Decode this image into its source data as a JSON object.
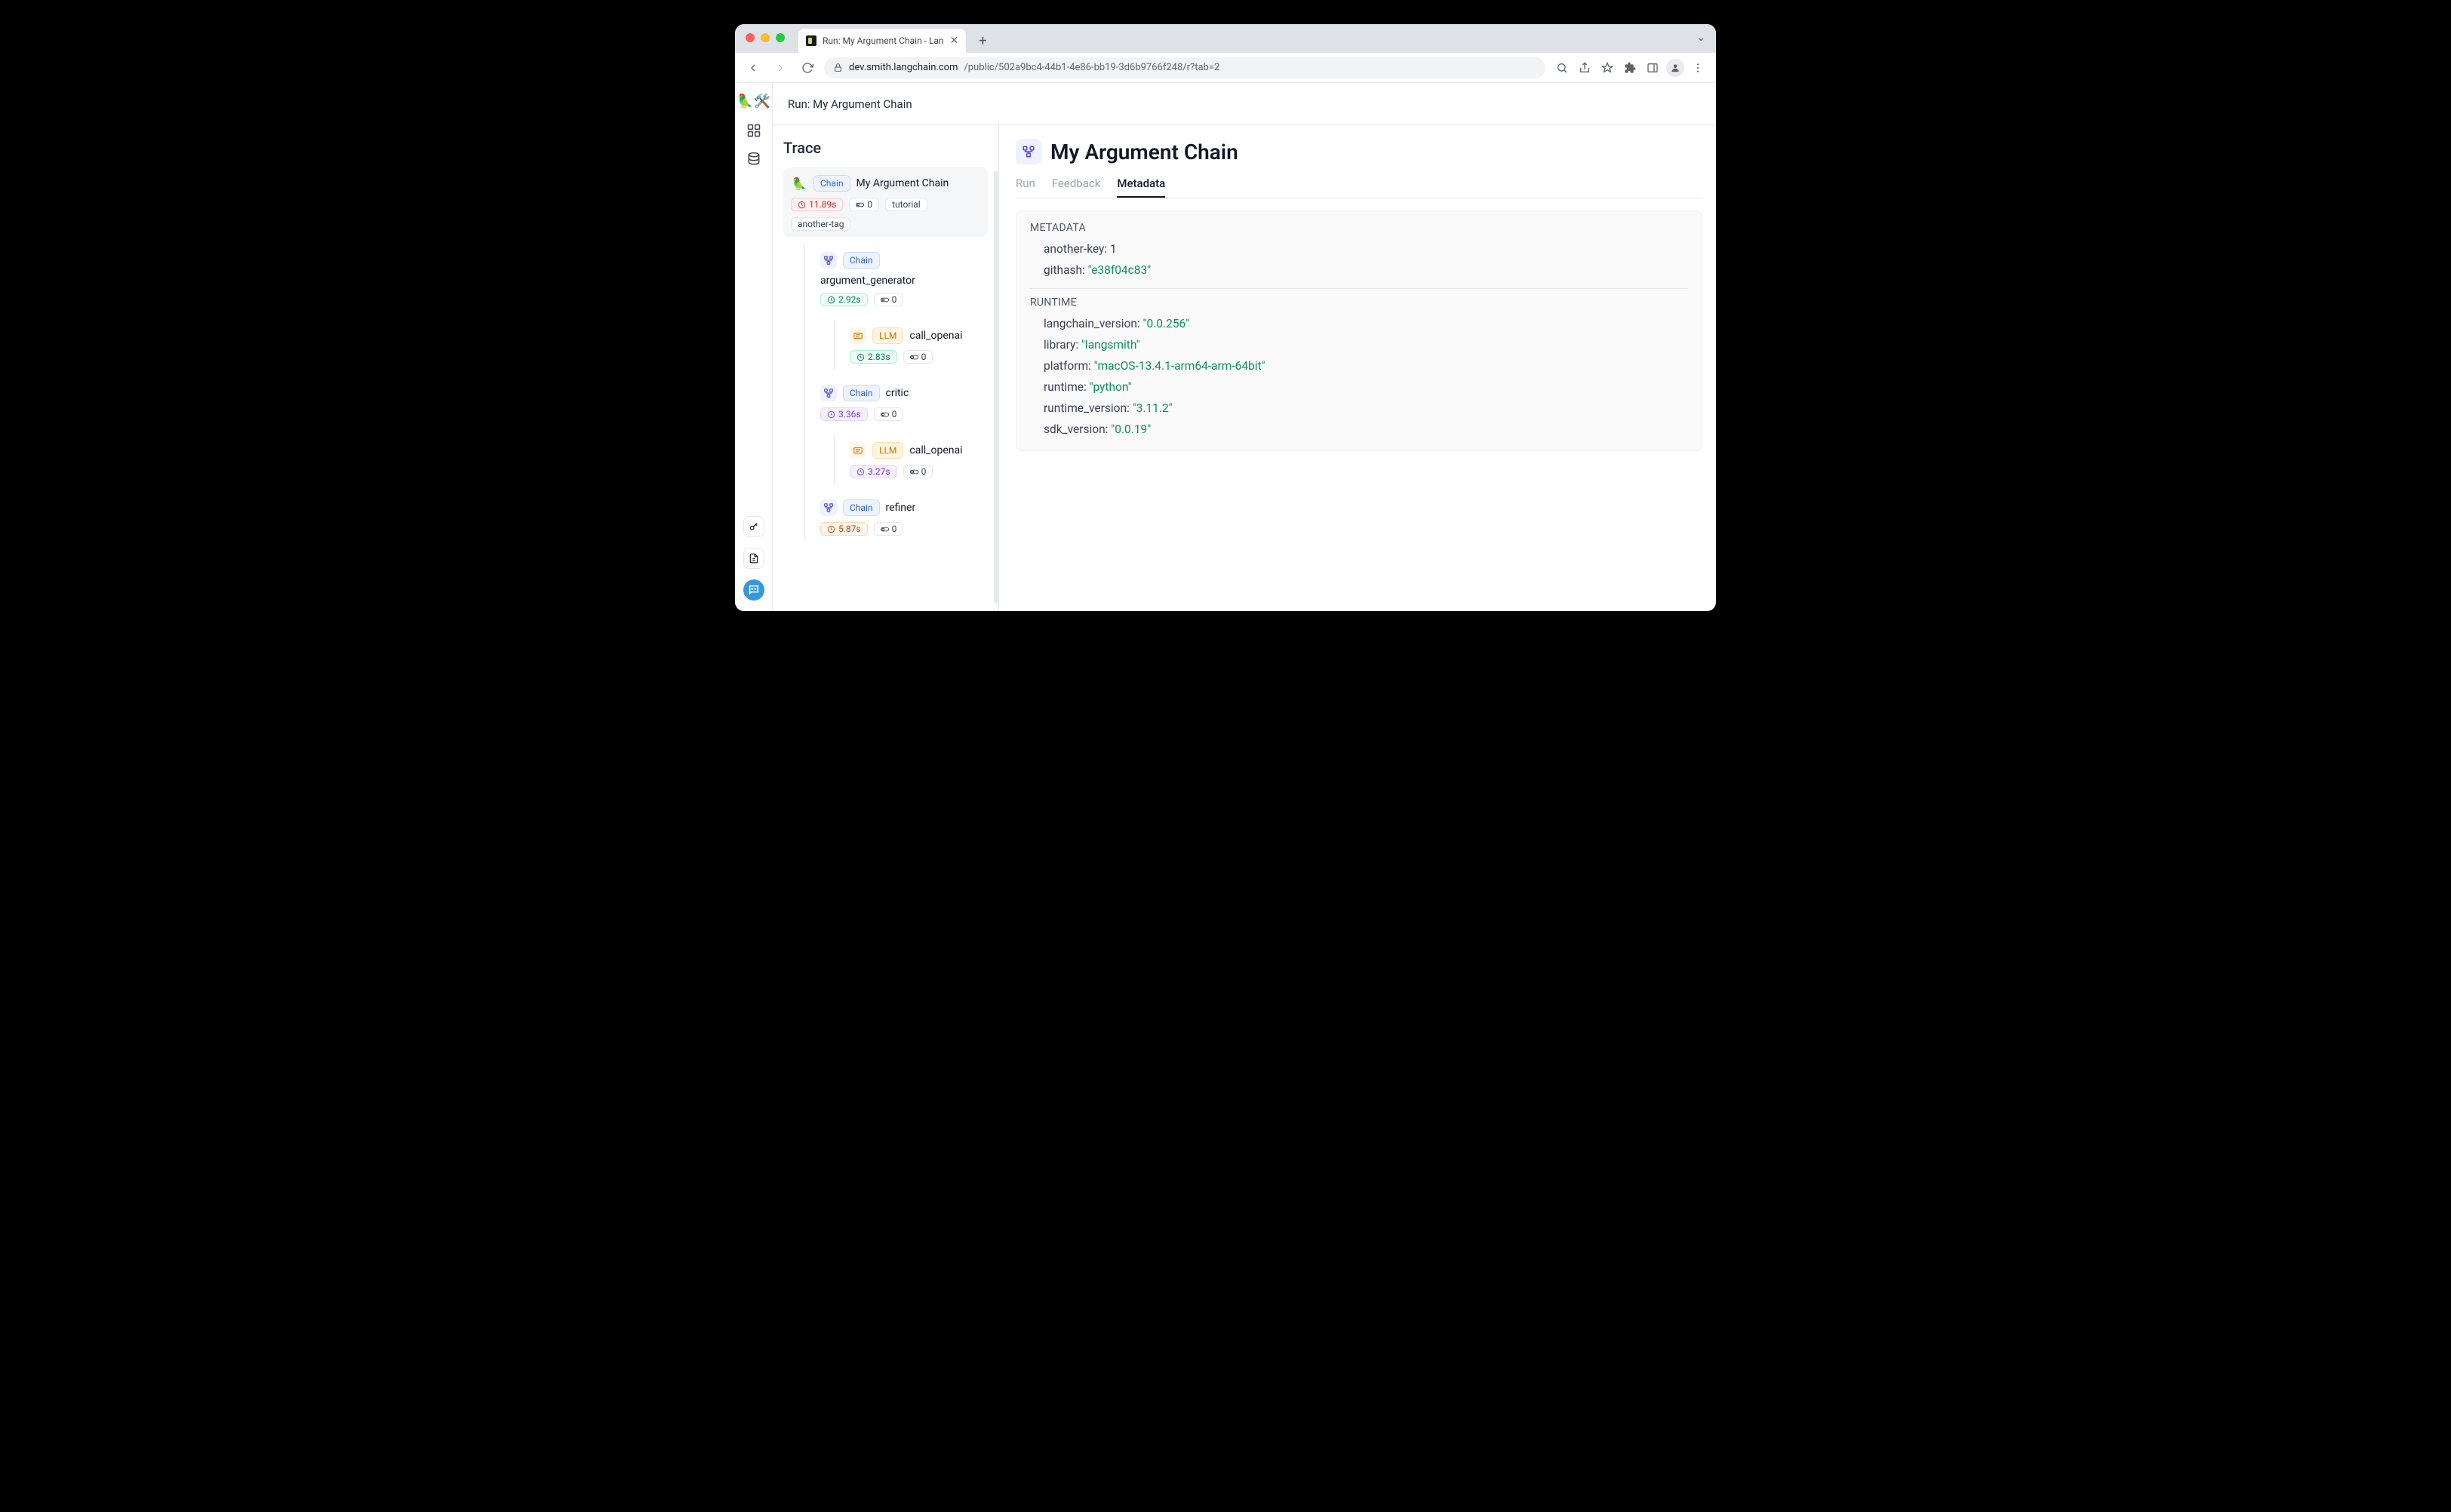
{
  "browser": {
    "tab_title": "Run: My Argument Chain - Lan",
    "url_host": "dev.smith.langchain.com",
    "url_path": "/public/502a9bc4-44b1-4e86-bb19-3d6b9766f248/r?tab=2"
  },
  "rail": {
    "logo": "🦜🛠️"
  },
  "breadcrumb": "Run: My Argument Chain",
  "trace": {
    "heading": "Trace",
    "root": {
      "type": "Chain",
      "name": "My Argument Chain",
      "time": "11.89s",
      "time_color": "red",
      "tokens": "0",
      "tags": [
        "tutorial",
        "another-tag"
      ]
    },
    "nodes": [
      {
        "type": "Chain",
        "name": "argument_generator",
        "time": "2.92s",
        "time_color": "green",
        "tokens": "0",
        "children": [
          {
            "type": "LLM",
            "name": "call_openai",
            "time": "2.83s",
            "time_color": "green",
            "tokens": "0"
          }
        ]
      },
      {
        "type": "Chain",
        "name": "critic",
        "time": "3.36s",
        "time_color": "purple",
        "tokens": "0",
        "children": [
          {
            "type": "LLM",
            "name": "call_openai",
            "time": "3.27s",
            "time_color": "purple",
            "tokens": "0"
          }
        ]
      },
      {
        "type": "Chain",
        "name": "refiner",
        "time": "5.87s",
        "time_color": "orange",
        "tokens": "0",
        "children": []
      }
    ]
  },
  "detail": {
    "title": "My Argument Chain",
    "tabs": [
      "Run",
      "Feedback",
      "Metadata"
    ],
    "active_tab": "Metadata",
    "metadata_heading": "METADATA",
    "metadata": [
      {
        "k": "another-key",
        "v": "1",
        "quoted": false
      },
      {
        "k": "githash",
        "v": "e38f04c83",
        "quoted": true
      }
    ],
    "runtime_heading": "RUNTIME",
    "runtime": [
      {
        "k": "langchain_version",
        "v": "0.0.256",
        "quoted": true
      },
      {
        "k": "library",
        "v": "langsmith",
        "quoted": true
      },
      {
        "k": "platform",
        "v": "macOS-13.4.1-arm64-arm-64bit",
        "quoted": true
      },
      {
        "k": "runtime",
        "v": "python",
        "quoted": true
      },
      {
        "k": "runtime_version",
        "v": "3.11.2",
        "quoted": true
      },
      {
        "k": "sdk_version",
        "v": "0.0.19",
        "quoted": true
      }
    ]
  }
}
